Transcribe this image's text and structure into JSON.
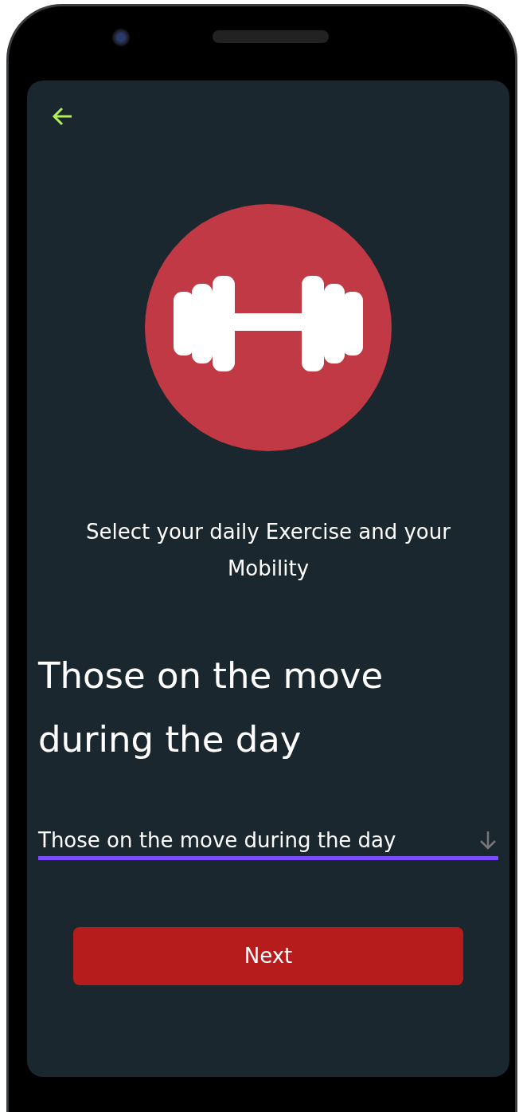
{
  "subtitle": "Select your daily  Exercise and your Mobility",
  "heading": "Those on the move during the day",
  "dropdown": {
    "value": "Those on the move during the day"
  },
  "next_button": {
    "label": "Next"
  }
}
